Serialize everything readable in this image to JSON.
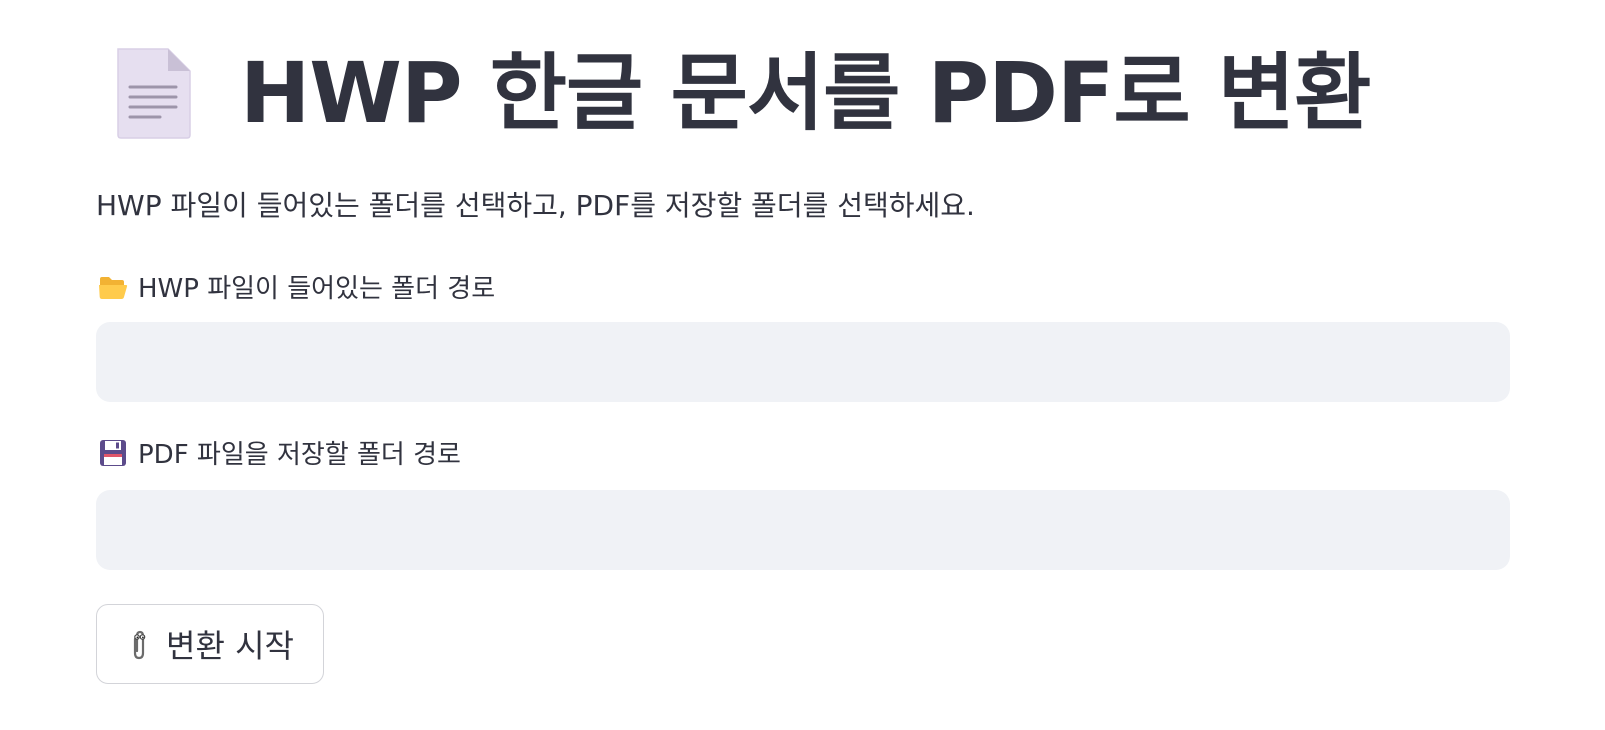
{
  "header": {
    "icon": "document-icon",
    "title": "HWP 한글 문서를 PDF로 변환"
  },
  "intro_text": "HWP 파일이 들어있는 폴더를 선택하고, PDF를 저장할 폴더를 선택하세요.",
  "fields": [
    {
      "icon": "open-folder-icon",
      "label": "HWP 파일이 들어있는 폴더 경로",
      "value": "",
      "placeholder": ""
    },
    {
      "icon": "floppy-disk-icon",
      "label": "PDF 파일을 저장할 폴더 경로",
      "value": "",
      "placeholder": ""
    }
  ],
  "start_button": {
    "icon": "paperclip-icon",
    "label": "변환 시작"
  },
  "colors": {
    "text": "#31333f",
    "input_bg": "#f0f2f6",
    "button_border": "#d3d4d9",
    "background": "#ffffff"
  }
}
